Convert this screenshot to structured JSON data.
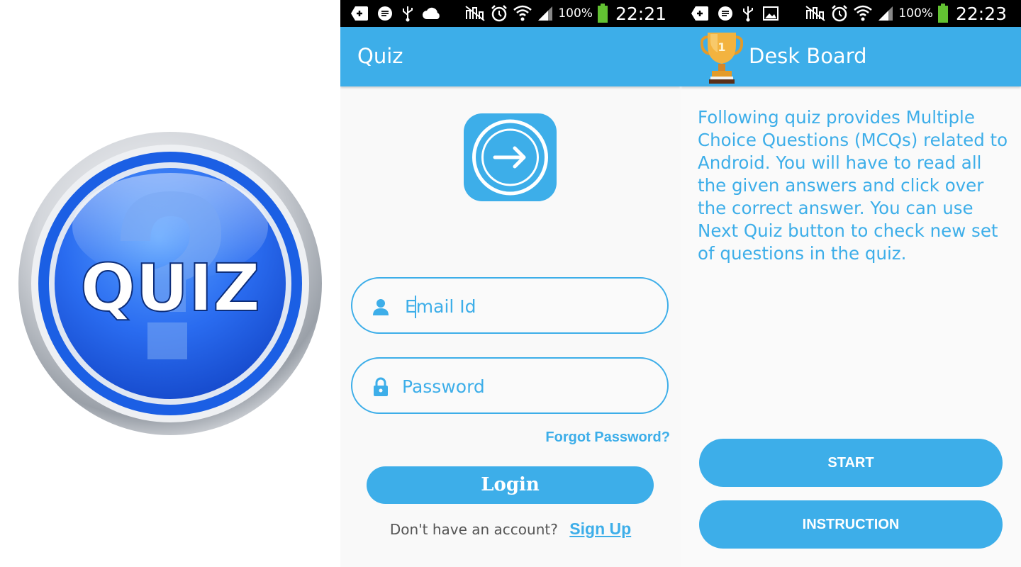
{
  "left_image": {
    "badge_text": "QUIZ"
  },
  "login_screen": {
    "status": {
      "battery": "100%",
      "time": "22:21"
    },
    "title": "Quiz",
    "email_placeholder": "Email Id",
    "password_placeholder": "Password",
    "forgot_password": "Forgot Password?",
    "login_label": "Login",
    "no_account_text": "Don't have an account?",
    "signup_label": "Sign Up"
  },
  "deskboard_screen": {
    "status": {
      "battery": "100%",
      "time": "22:23"
    },
    "title": "Desk Board",
    "trophy_number": "1",
    "description": "Following quiz provides Multiple Choice Questions (MCQs) related to Android. You will have to read all the given answers and click over the correct answer. You can use Next Quiz button to check new set of questions in the quiz.",
    "start_label": "START",
    "instruction_label": "INSTRUCTION"
  },
  "colors": {
    "accent": "#3daee9",
    "status_bar": "#000000",
    "badge_blue": "#1a5fe0",
    "silver_ring": "#c7cbd1"
  },
  "icons": [
    "quiz-badge-icon",
    "login-arrow-icon",
    "person-icon",
    "lock-icon",
    "trophy-icon",
    "wifi-icon",
    "signal-icon",
    "battery-icon",
    "alarm-icon",
    "usb-icon"
  ]
}
